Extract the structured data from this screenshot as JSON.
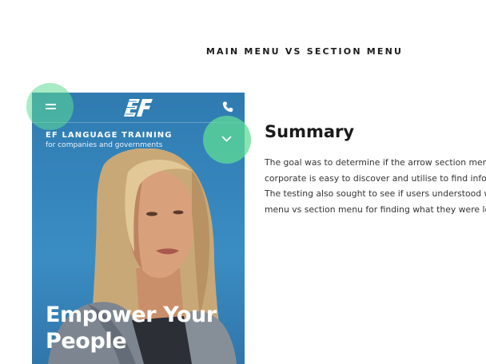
{
  "page": {
    "heading": "MAIN MENU VS SECTION MENU"
  },
  "mobile_mockup": {
    "brand_title": "EF LANGUAGE TRAINING",
    "brand_subtitle": "for companies and governments",
    "logo_text": "EF",
    "hero_headline": [
      "Empower Your",
      "People"
    ],
    "icons": {
      "menu": "hamburger-menu-icon",
      "phone": "phone-icon",
      "section_menu": "chevron-down-icon",
      "logo": "ef-logo"
    },
    "colors": {
      "header_blue": "#2f7bb0",
      "highlight_green": "#5fdc96",
      "text_white": "#ffffff"
    }
  },
  "summary": {
    "title": "Summary",
    "body_lines": [
      "The goal was to determine if the arrow section menu cur",
      "corporate is easy to discover and utilise to find informati",
      "The testing also sought to see if users understood when",
      "menu vs section menu for finding what they were lookin"
    ]
  }
}
